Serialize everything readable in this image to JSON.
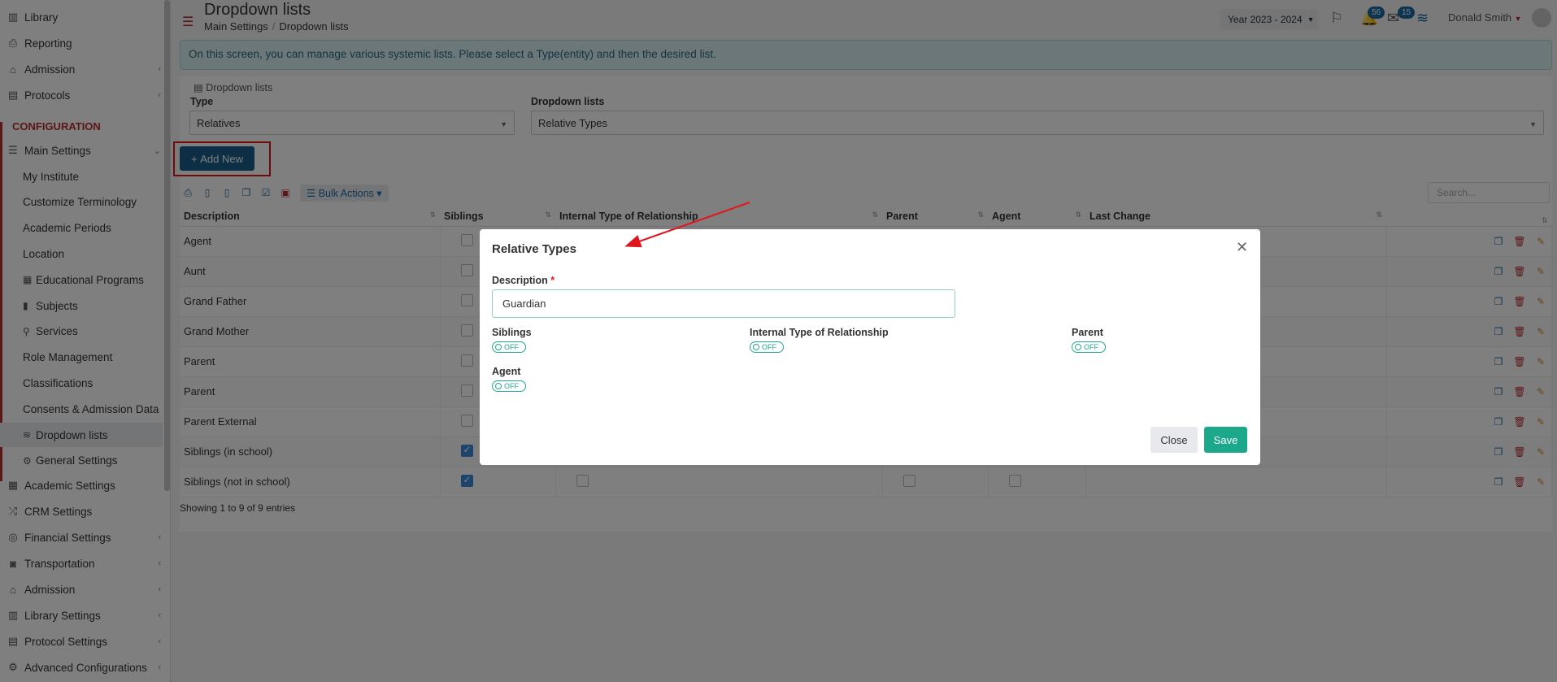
{
  "sidebar": {
    "top_items": [
      {
        "label": "Library",
        "icon": "books-icon"
      },
      {
        "label": "Reporting",
        "icon": "printer-icon"
      },
      {
        "label": "Admission",
        "icon": "institution-icon"
      },
      {
        "label": "Protocols",
        "icon": "document-icon"
      }
    ],
    "section": "CONFIGURATION",
    "main_settings": "Main Settings",
    "sub_items": [
      {
        "label": "My Institute",
        "icon": ""
      },
      {
        "label": "Customize Terminology",
        "icon": ""
      },
      {
        "label": "Academic Periods",
        "icon": ""
      },
      {
        "label": "Location",
        "icon": ""
      },
      {
        "label": "Educational Programs",
        "icon": "programs-icon"
      },
      {
        "label": "Subjects",
        "icon": "book-icon"
      },
      {
        "label": "Services",
        "icon": "services-icon"
      },
      {
        "label": "Role Management",
        "icon": ""
      },
      {
        "label": "Classifications",
        "icon": ""
      },
      {
        "label": "Consents & Admission Data",
        "icon": ""
      },
      {
        "label": "Dropdown lists",
        "icon": "layers-icon"
      },
      {
        "label": "General Settings",
        "icon": "gear-icon"
      }
    ],
    "bottom_items": [
      {
        "label": "Academic Settings",
        "icon": "grid-icon"
      },
      {
        "label": "CRM Settings",
        "icon": "shuffle-icon"
      },
      {
        "label": "Financial Settings",
        "icon": "coins-icon"
      },
      {
        "label": "Transportation",
        "icon": "bus-icon"
      },
      {
        "label": "Admission",
        "icon": "institution-icon"
      },
      {
        "label": "Library Settings",
        "icon": "books-icon"
      },
      {
        "label": "Protocol Settings",
        "icon": "document-icon"
      },
      {
        "label": "Advanced Configurations",
        "icon": "gears-icon"
      }
    ]
  },
  "header": {
    "title": "Dropdown lists",
    "breadcrumb": [
      "Main Settings",
      "Dropdown lists"
    ],
    "year": "Year 2023 - 2024",
    "notifications_count": "56",
    "messages_count": "15",
    "user": "Donald Smith"
  },
  "info": "On this screen, you can manage various systemic lists. Please select a Type(entity) and then the desired list.",
  "panel": {
    "title": "Dropdown lists",
    "type_label": "Type",
    "type_value": "Relatives",
    "list_label": "Dropdown lists",
    "list_value": "Relative Types",
    "add_new": "Add New",
    "bulk_actions": "Bulk Actions",
    "search_placeholder": "Search...",
    "columns": [
      "Description",
      "Siblings",
      "Internal Type of Relationship",
      "Parent",
      "Agent",
      "Last Change"
    ],
    "rows": [
      {
        "description": "Agent",
        "siblings": false
      },
      {
        "description": "Aunt",
        "siblings": false
      },
      {
        "description": "Grand Father",
        "siblings": false
      },
      {
        "description": "Grand Mother",
        "siblings": false
      },
      {
        "description": "Parent",
        "siblings": false
      },
      {
        "description": "Parent",
        "siblings": false
      },
      {
        "description": "Parent External",
        "siblings": false
      },
      {
        "description": "Siblings (in school)",
        "siblings": true
      },
      {
        "description": "Siblings (not in school)",
        "siblings": true
      }
    ],
    "entries": "Showing 1 to 9 of 9 entries"
  },
  "modal": {
    "title": "Relative Types",
    "description_label": "Description",
    "required_mark": "*",
    "description_value": "Guardian",
    "siblings_label": "Siblings",
    "internal_label": "Internal Type of Relationship",
    "parent_label": "Parent",
    "agent_label": "Agent",
    "toggle_off": "OFF",
    "close": "Close",
    "save": "Save"
  },
  "colors": {
    "accent": "#1b5f8a",
    "brand_red": "#b72c31",
    "save_green": "#1ca88a",
    "highlight": "#e0161b"
  }
}
